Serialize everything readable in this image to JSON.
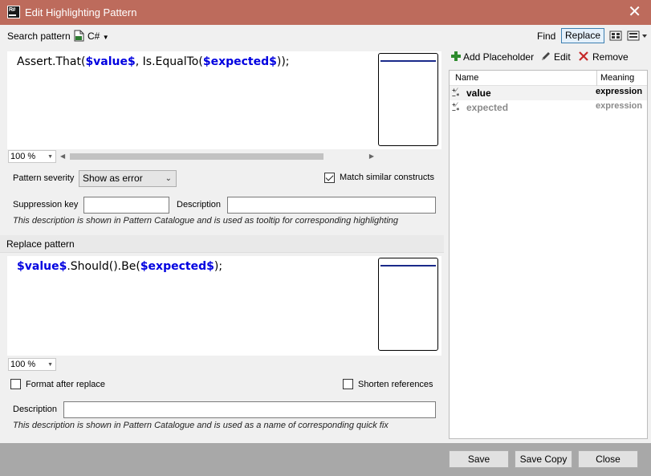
{
  "window": {
    "title": "Edit Highlighting Pattern"
  },
  "search": {
    "label": "Search pattern",
    "language": "C#",
    "code_parts": [
      {
        "text": "Assert.That(",
        "ph": false
      },
      {
        "text": "$value$",
        "ph": true
      },
      {
        "text": ", Is.EqualTo(",
        "ph": false
      },
      {
        "text": "$expected$",
        "ph": true
      },
      {
        "text": "));",
        "ph": false
      }
    ],
    "zoom": "100 %"
  },
  "mode": {
    "find": "Find",
    "replace": "Replace"
  },
  "options": {
    "severity_label": "Pattern severity",
    "severity_value": "Show as error",
    "match_similar_label": "Match similar constructs",
    "match_similar_checked": true,
    "suppression_label": "Suppression key",
    "suppression_value": "",
    "description_label": "Description",
    "description_value": "",
    "description_hint": "This description is shown in Pattern Catalogue and is used as tooltip for corresponding highlighting"
  },
  "replace": {
    "label": "Replace pattern",
    "code_parts": [
      {
        "text": "$value$",
        "ph": true
      },
      {
        "text": ".Should().Be(",
        "ph": false
      },
      {
        "text": "$expected$",
        "ph": true
      },
      {
        "text": ");",
        "ph": false
      }
    ],
    "zoom": "100 %",
    "format_label": "Format after replace",
    "format_checked": false,
    "shorten_label": "Shorten references",
    "shorten_checked": false,
    "description_label": "Description",
    "description_value": "",
    "description_hint": "This description is shown in Pattern Catalogue and is used as a name of corresponding quick fix"
  },
  "placeholders": {
    "add_label": "Add Placeholder",
    "edit_label": "Edit",
    "remove_label": "Remove",
    "col_name": "Name",
    "col_meaning": "Meaning",
    "rows": [
      {
        "name": "value",
        "meaning": "expression",
        "selected": true
      },
      {
        "name": "expected",
        "meaning": "expression",
        "selected": false
      }
    ]
  },
  "footer": {
    "save": "Save",
    "save_copy": "Save Copy",
    "close": "Close"
  }
}
